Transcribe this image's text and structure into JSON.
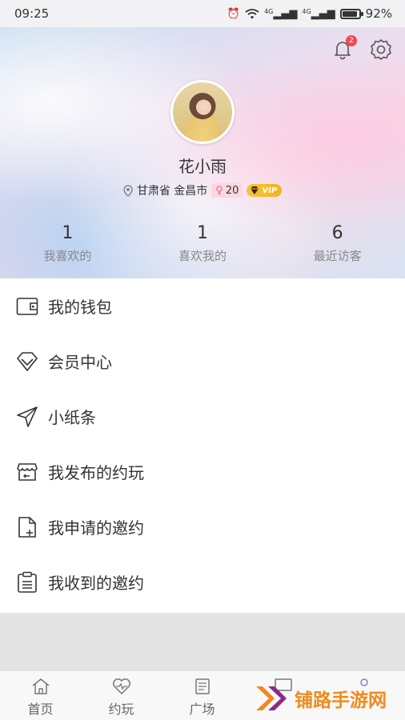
{
  "status": {
    "time": "09:25",
    "net1": "4G",
    "net2": "4G",
    "battery": "92%",
    "battery_level": 0.92
  },
  "header": {
    "notification_count": "2"
  },
  "profile": {
    "name": "花小雨",
    "location": "甘肃省 金昌市",
    "age": "20",
    "gender_symbol": "♀",
    "vip_label": "VIP"
  },
  "stats": [
    {
      "count": "1",
      "label": "我喜欢的"
    },
    {
      "count": "1",
      "label": "喜欢我的"
    },
    {
      "count": "6",
      "label": "最近访客"
    }
  ],
  "menu": [
    {
      "label": "我的钱包",
      "icon": "wallet-icon"
    },
    {
      "label": "会员中心",
      "icon": "diamond-icon"
    },
    {
      "label": "小纸条",
      "icon": "paper-plane-icon"
    },
    {
      "label": "我发布的约玩",
      "icon": "store-icon"
    },
    {
      "label": "我申请的邀约",
      "icon": "document-add-icon"
    },
    {
      "label": "我收到的邀约",
      "icon": "clipboard-icon"
    }
  ],
  "tabs": [
    {
      "label": "首页",
      "icon": "home-icon"
    },
    {
      "label": "约玩",
      "icon": "heartbeat-icon"
    },
    {
      "label": "广场",
      "icon": "notes-icon"
    },
    {
      "label": "",
      "icon": "message-icon"
    },
    {
      "label": "",
      "icon": "profile-icon"
    }
  ],
  "watermark": {
    "text": "铺路手游网"
  },
  "colors": {
    "badge_red": "#f04a4a",
    "vip_gold": "#f2bc2c",
    "gender_pink": "#f0658f",
    "watermark_orange": "#f08a1c"
  }
}
